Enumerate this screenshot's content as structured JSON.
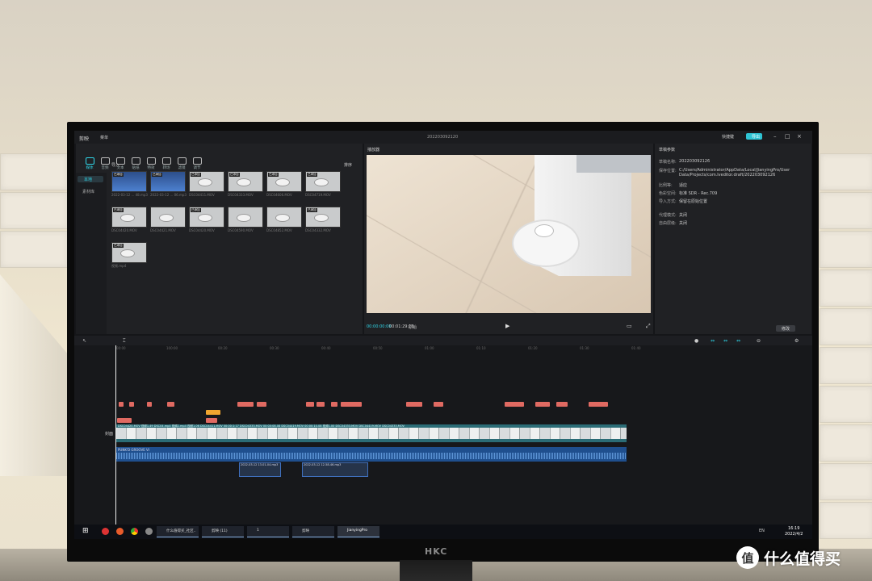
{
  "window": {
    "title": "202203092120",
    "app_name": "剪映",
    "menu": "菜单"
  },
  "top_right": {
    "shortcut": "快捷键",
    "export": "导出"
  },
  "tabs": [
    "媒体",
    "音频",
    "文本",
    "贴纸",
    "特效",
    "转场",
    "滤镜",
    "调节"
  ],
  "media_sidebar": [
    "本地",
    "素材库"
  ],
  "media_header": {
    "import": "导入",
    "sort": "排序"
  },
  "media_items": [
    {
      "label": "2022-03-12 ... 48.mp3",
      "badge": "已添加",
      "kind": "audio"
    },
    {
      "label": "2022-03-12 ... 06.mp3",
      "badge": "已添加",
      "kind": "audio"
    },
    {
      "label": "DSC04411.MOV",
      "badge": "已添加",
      "kind": "video"
    },
    {
      "label": "DSC04333.MOV",
      "badge": "已添加",
      "kind": "video"
    },
    {
      "label": "DSC04606.MOV",
      "badge": "已添加",
      "kind": "video"
    },
    {
      "label": "DSC04719.MOV",
      "badge": "已添加",
      "kind": "video"
    },
    {
      "label": "DSC04420.MOV",
      "badge": "已添加",
      "kind": "video"
    },
    {
      "label": "DSC04421.MOV",
      "badge": "",
      "kind": "video"
    },
    {
      "label": "DSC04420.MOV",
      "badge": "已添加",
      "kind": "video"
    },
    {
      "label": "DSC04590.MOV",
      "badge": "",
      "kind": "video"
    },
    {
      "label": "DSC04852.MOV",
      "badge": "",
      "kind": "video"
    },
    {
      "label": "DSC04332.MOV",
      "badge": "已添加",
      "kind": "video"
    },
    {
      "label": "视频.mp4",
      "badge": "已添加",
      "kind": "video"
    }
  ],
  "player": {
    "title": "播放器",
    "current": "00:00:00:00",
    "total": "00:01:29:16",
    "ratio": "原始"
  },
  "draft": {
    "title": "草稿参数",
    "rows": [
      {
        "k": "草稿名称:",
        "v": "202203092126"
      },
      {
        "k": "保存位置:",
        "v": "C:/Users/Administrator/AppData/Local/JianyingPro/User Data/Projects/com.lveditor.draft/202203092126"
      },
      {
        "k": "比例等:",
        "v": "适应"
      },
      {
        "k": "色彩空间:",
        "v": "标准 SDR - Rec.709"
      },
      {
        "k": "导入方式:",
        "v": "保留在原始位置"
      },
      {
        "k": "代理模式:",
        "v": "关闭"
      },
      {
        "k": "自由层级:",
        "v": "关闭"
      }
    ],
    "modify": "修改"
  },
  "timeline": {
    "ticks": [
      "00:00",
      "100:00",
      "00:20",
      "00:30",
      "00:40",
      "00:50",
      "01:00",
      "01:10",
      "01:20",
      "01:30",
      "01:40"
    ],
    "cover_label": "封面",
    "video_clips": [
      "DSC04420.MOV",
      "DSC0",
      "视频1.49",
      "DSC0",
      "DSC04.mp4",
      "视频2.mp4",
      "视频1.06",
      "DSC04411.MOV",
      "00:00:1:17",
      "DSC04333.MOV",
      "00:00:08.08",
      "DSC04419.MOV",
      "00:00:10.08",
      "视频1.00",
      "DSC04333.MOV",
      "DSC04419.MOV",
      "DSC04333.MOV",
      "DSC04333.MOV",
      "DSC04333.MOV",
      "DSC04333.MOV"
    ],
    "music_label": "PUNK'D GROOVE VI",
    "audio_clips": [
      "2022-03-12 13-01-04.mp3",
      "2022-03-12 12-58-46.mp3"
    ]
  },
  "taskbar": {
    "apps": [
      "什么值得买_社区..",
      "剪映 (11)",
      "1",
      "剪映",
      "JianyingPro"
    ],
    "time": "16:19",
    "date": "2022/4/2",
    "lang": "EN"
  },
  "monitor_brand": "HKC",
  "watermark": {
    "logo": "值",
    "text": "什么值得买"
  }
}
